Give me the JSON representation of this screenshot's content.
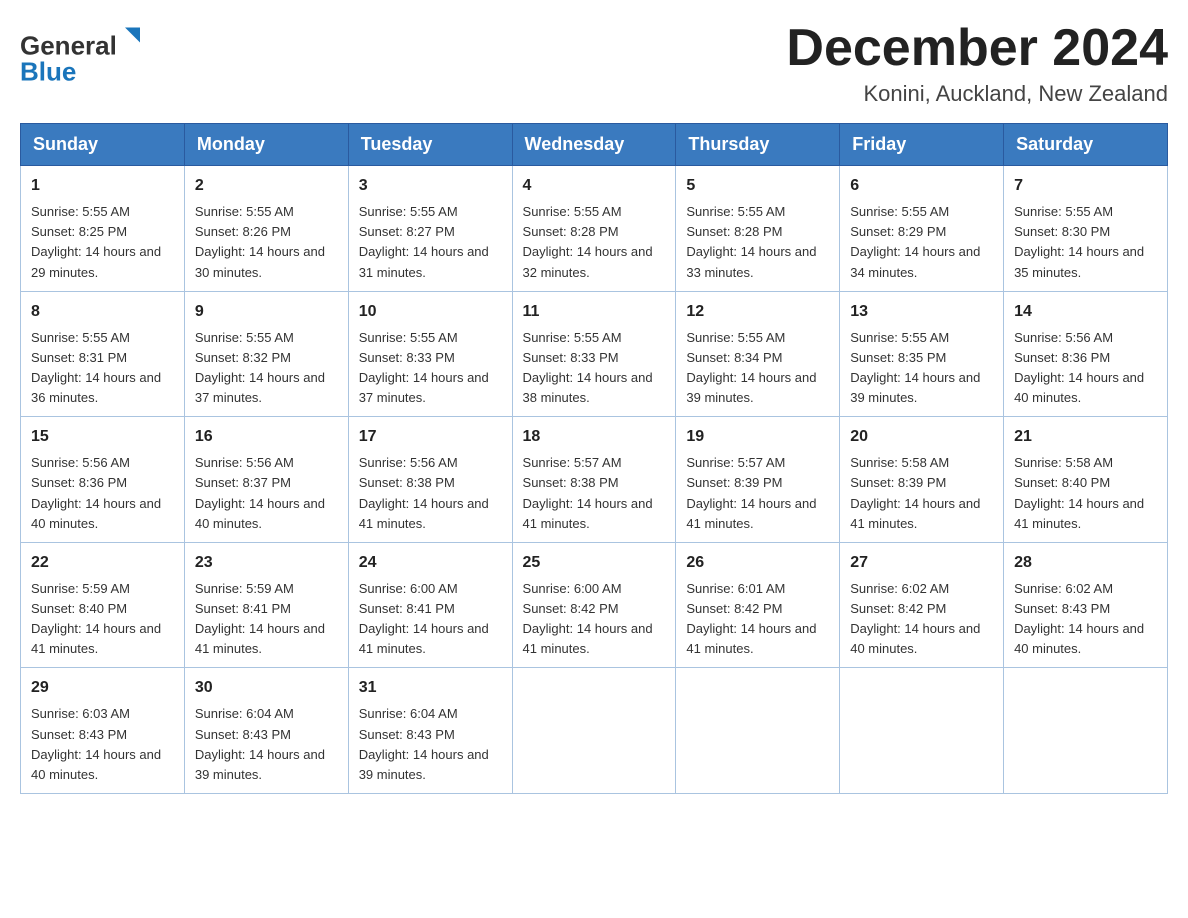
{
  "header": {
    "logo_line1": "General",
    "logo_line2": "Blue",
    "month_title": "December 2024",
    "location": "Konini, Auckland, New Zealand"
  },
  "weekdays": [
    "Sunday",
    "Monday",
    "Tuesday",
    "Wednesday",
    "Thursday",
    "Friday",
    "Saturday"
  ],
  "weeks": [
    [
      {
        "day": "1",
        "sunrise": "5:55 AM",
        "sunset": "8:25 PM",
        "daylight": "14 hours and 29 minutes."
      },
      {
        "day": "2",
        "sunrise": "5:55 AM",
        "sunset": "8:26 PM",
        "daylight": "14 hours and 30 minutes."
      },
      {
        "day": "3",
        "sunrise": "5:55 AM",
        "sunset": "8:27 PM",
        "daylight": "14 hours and 31 minutes."
      },
      {
        "day": "4",
        "sunrise": "5:55 AM",
        "sunset": "8:28 PM",
        "daylight": "14 hours and 32 minutes."
      },
      {
        "day": "5",
        "sunrise": "5:55 AM",
        "sunset": "8:28 PM",
        "daylight": "14 hours and 33 minutes."
      },
      {
        "day": "6",
        "sunrise": "5:55 AM",
        "sunset": "8:29 PM",
        "daylight": "14 hours and 34 minutes."
      },
      {
        "day": "7",
        "sunrise": "5:55 AM",
        "sunset": "8:30 PM",
        "daylight": "14 hours and 35 minutes."
      }
    ],
    [
      {
        "day": "8",
        "sunrise": "5:55 AM",
        "sunset": "8:31 PM",
        "daylight": "14 hours and 36 minutes."
      },
      {
        "day": "9",
        "sunrise": "5:55 AM",
        "sunset": "8:32 PM",
        "daylight": "14 hours and 37 minutes."
      },
      {
        "day": "10",
        "sunrise": "5:55 AM",
        "sunset": "8:33 PM",
        "daylight": "14 hours and 37 minutes."
      },
      {
        "day": "11",
        "sunrise": "5:55 AM",
        "sunset": "8:33 PM",
        "daylight": "14 hours and 38 minutes."
      },
      {
        "day": "12",
        "sunrise": "5:55 AM",
        "sunset": "8:34 PM",
        "daylight": "14 hours and 39 minutes."
      },
      {
        "day": "13",
        "sunrise": "5:55 AM",
        "sunset": "8:35 PM",
        "daylight": "14 hours and 39 minutes."
      },
      {
        "day": "14",
        "sunrise": "5:56 AM",
        "sunset": "8:36 PM",
        "daylight": "14 hours and 40 minutes."
      }
    ],
    [
      {
        "day": "15",
        "sunrise": "5:56 AM",
        "sunset": "8:36 PM",
        "daylight": "14 hours and 40 minutes."
      },
      {
        "day": "16",
        "sunrise": "5:56 AM",
        "sunset": "8:37 PM",
        "daylight": "14 hours and 40 minutes."
      },
      {
        "day": "17",
        "sunrise": "5:56 AM",
        "sunset": "8:38 PM",
        "daylight": "14 hours and 41 minutes."
      },
      {
        "day": "18",
        "sunrise": "5:57 AM",
        "sunset": "8:38 PM",
        "daylight": "14 hours and 41 minutes."
      },
      {
        "day": "19",
        "sunrise": "5:57 AM",
        "sunset": "8:39 PM",
        "daylight": "14 hours and 41 minutes."
      },
      {
        "day": "20",
        "sunrise": "5:58 AM",
        "sunset": "8:39 PM",
        "daylight": "14 hours and 41 minutes."
      },
      {
        "day": "21",
        "sunrise": "5:58 AM",
        "sunset": "8:40 PM",
        "daylight": "14 hours and 41 minutes."
      }
    ],
    [
      {
        "day": "22",
        "sunrise": "5:59 AM",
        "sunset": "8:40 PM",
        "daylight": "14 hours and 41 minutes."
      },
      {
        "day": "23",
        "sunrise": "5:59 AM",
        "sunset": "8:41 PM",
        "daylight": "14 hours and 41 minutes."
      },
      {
        "day": "24",
        "sunrise": "6:00 AM",
        "sunset": "8:41 PM",
        "daylight": "14 hours and 41 minutes."
      },
      {
        "day": "25",
        "sunrise": "6:00 AM",
        "sunset": "8:42 PM",
        "daylight": "14 hours and 41 minutes."
      },
      {
        "day": "26",
        "sunrise": "6:01 AM",
        "sunset": "8:42 PM",
        "daylight": "14 hours and 41 minutes."
      },
      {
        "day": "27",
        "sunrise": "6:02 AM",
        "sunset": "8:42 PM",
        "daylight": "14 hours and 40 minutes."
      },
      {
        "day": "28",
        "sunrise": "6:02 AM",
        "sunset": "8:43 PM",
        "daylight": "14 hours and 40 minutes."
      }
    ],
    [
      {
        "day": "29",
        "sunrise": "6:03 AM",
        "sunset": "8:43 PM",
        "daylight": "14 hours and 40 minutes."
      },
      {
        "day": "30",
        "sunrise": "6:04 AM",
        "sunset": "8:43 PM",
        "daylight": "14 hours and 39 minutes."
      },
      {
        "day": "31",
        "sunrise": "6:04 AM",
        "sunset": "8:43 PM",
        "daylight": "14 hours and 39 minutes."
      },
      null,
      null,
      null,
      null
    ]
  ],
  "labels": {
    "sunrise_prefix": "Sunrise: ",
    "sunset_prefix": "Sunset: ",
    "daylight_prefix": "Daylight: "
  }
}
